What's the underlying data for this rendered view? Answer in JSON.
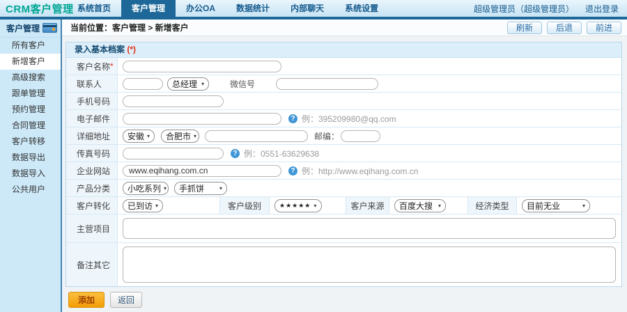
{
  "topbar": {
    "logo": "CRM客户管理",
    "nav": [
      "系统首页",
      "客户管理",
      "办公OA",
      "数据统计",
      "内部聊天",
      "系统设置"
    ],
    "nav_active_index": 1,
    "user": "超级管理员（超级管理员）",
    "logout": "退出登录"
  },
  "sidebar": {
    "title": "客户管理",
    "items": [
      "所有客户",
      "新增客户",
      "高级搜索",
      "跟单管理",
      "预约管理",
      "合同管理",
      "客户转移",
      "数据导出",
      "数据导入",
      "公共用户"
    ],
    "active_item": "新增客户"
  },
  "breadcrumb": {
    "label": "当前位置：客户管理 > 新增客户",
    "refresh": "刷新",
    "back": "后退",
    "forward": "前进"
  },
  "form": {
    "section_title": "录入基本档案",
    "section_required": "(*)",
    "name": {
      "label": "客户名称",
      "required": "*",
      "value": ""
    },
    "contact": {
      "label": "联系人",
      "value": "",
      "title": "总经理",
      "wechat_label": "微信号",
      "wechat_value": ""
    },
    "mobile": {
      "label": "手机号码",
      "value": ""
    },
    "email": {
      "label": "电子邮件",
      "value": "",
      "hint": "例：395209980@qq.com"
    },
    "address": {
      "label": "详细地址",
      "province": "安徽",
      "city": "合肥市",
      "street": "",
      "zip_label": "邮编：",
      "zip": ""
    },
    "fax": {
      "label": "传真号码",
      "value": "",
      "hint": "例：0551-63629638"
    },
    "website": {
      "label": "企业网站",
      "value": "www.eqihang.com.cn",
      "hint": "例：http://www.eqihang.com.cn"
    },
    "product": {
      "label": "产品分类",
      "category": "小吃系列",
      "item": "手抓饼"
    },
    "convert": {
      "label": "客户转化",
      "value": "已到访"
    },
    "level": {
      "label": "客户级别",
      "value": "★★★★★"
    },
    "source": {
      "label": "客户来源",
      "value": "百度大搜"
    },
    "economy": {
      "label": "经济类型",
      "value": "目前无业"
    },
    "main_business": {
      "label": "主营项目",
      "value": ""
    },
    "remark": {
      "label": "备注其它",
      "value": ""
    },
    "submit": "添加",
    "back": "返回"
  },
  "icons": {
    "help": "?",
    "select_arrow": "▾"
  },
  "colors": {
    "accent": "#1d6899",
    "logo": "#00a693",
    "submit": "#f29e07",
    "required": "#e03214"
  }
}
